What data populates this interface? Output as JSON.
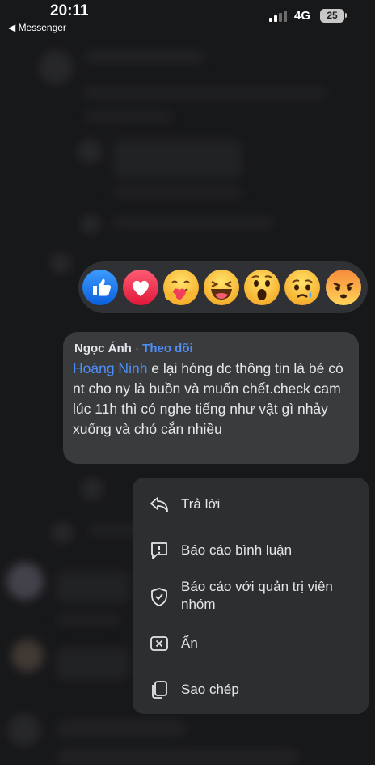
{
  "status": {
    "time": "20:11",
    "back_label": "◀ Messenger",
    "network": "4G",
    "battery": "25"
  },
  "reactions": [
    {
      "name": "like-reaction-icon"
    },
    {
      "name": "love-reaction-icon"
    },
    {
      "name": "care-reaction-icon"
    },
    {
      "name": "haha-reaction-icon"
    },
    {
      "name": "wow-reaction-icon"
    },
    {
      "name": "sad-reaction-icon"
    },
    {
      "name": "angry-reaction-icon"
    }
  ],
  "comment": {
    "author": "Ngọc Ánh",
    "separator": " · ",
    "follow_label": "Theo dõi",
    "mention": "Hoàng Ninh",
    "text": " e lại hóng dc thông tin là bé có nt cho ny là buồn và muốn chết.check cam lúc 11h thì có nghe tiếng như vật gì nhảy xuống và chó cắn nhiều"
  },
  "menu": {
    "reply": "Trả lời",
    "report_comment": "Báo cáo bình luận",
    "report_admin_line1": "Báo cáo với quản trị viên",
    "report_admin_line2": "nhóm",
    "hide": "Ẩn",
    "copy": "Sao chép"
  },
  "colors": {
    "accent": "#4e8ef7",
    "like": "#1877f2",
    "love": "#f33e58"
  }
}
